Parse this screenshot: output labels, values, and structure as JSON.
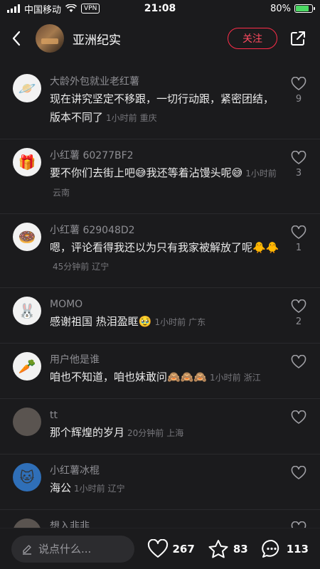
{
  "status_bar": {
    "carrier": "中国移动",
    "vpn": "VPN",
    "time": "21:08",
    "battery": "80%",
    "battery_level": 0.8
  },
  "header": {
    "title": "亚洲纪实",
    "follow_label": "关注"
  },
  "comments": [
    {
      "name": "大龄外包就业老红薯",
      "text": "现在讲究坚定不移跟，一切行动跟，紧密团结，版本不同了",
      "time": "1小时前",
      "location": "重庆",
      "likes": "9",
      "avatar": "planet-icon"
    },
    {
      "name": "小红薯 60277BF2",
      "text": "要不你们去街上吧😅我还等着沾馒头呢😅",
      "time": "1小时前",
      "location": "云南",
      "likes": "3",
      "avatar": "gift-icon"
    },
    {
      "name": "小红薯 629048D2",
      "text": "嗯，评论看得我还以为只有我家被解放了呢🐥🐥",
      "time": "45分钟前",
      "location": "辽宁",
      "likes": "1",
      "avatar": "donut-icon"
    },
    {
      "name": "MOMO",
      "text": "感谢祖国 热泪盈眶🥹",
      "time": "1小时前",
      "location": "广东",
      "likes": "2",
      "avatar": "bunny-icon"
    },
    {
      "name": "用户他是谁",
      "text": "咱也不知道，咱也妹敢问🙈🙈🙈",
      "time": "1小时前",
      "location": "浙江",
      "likes": "",
      "avatar": "carrot-icon"
    },
    {
      "name": "tt",
      "text": "那个辉煌的岁月",
      "time": "20分钟前",
      "location": "上海",
      "likes": "",
      "avatar": "photo-avatar"
    },
    {
      "name": "小红薯冰棍",
      "text": "海公",
      "time": "1小时前",
      "location": "辽宁",
      "likes": "",
      "avatar": "doraemon-icon"
    },
    {
      "name": "想入非非",
      "text": "",
      "time": "",
      "location": "",
      "likes": "",
      "avatar": "photo-avatar"
    }
  ],
  "bottom_bar": {
    "input_placeholder": "说点什么...",
    "likes": "267",
    "stars": "83",
    "comments": "113"
  },
  "colors": {
    "background": "#1b1b1d",
    "accent": "#ff2d4a",
    "battery": "#4cd964"
  }
}
